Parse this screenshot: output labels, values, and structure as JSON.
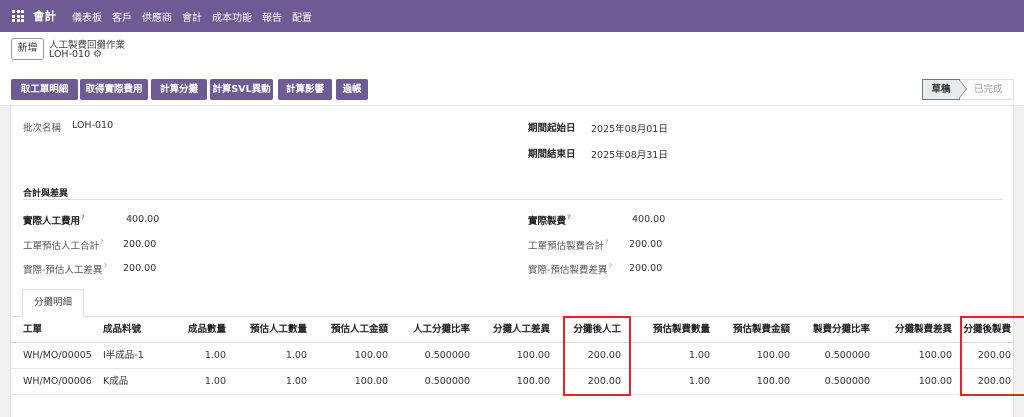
{
  "topnav": {
    "brand": "會計",
    "menu": [
      "儀表板",
      "客戶",
      "供應商",
      "會計",
      "成本功能",
      "報告",
      "配置"
    ]
  },
  "breadcrumb": {
    "new_label": "新增",
    "title": "人工製費回攤作業",
    "record": "LOH-010"
  },
  "actions": [
    "取工單明細",
    "取得實際費用",
    "計算分攤",
    "計算SVL異動",
    "計算影響",
    "過帳"
  ],
  "status": {
    "current": "草稿",
    "next": "已完成"
  },
  "form": {
    "batch_label": "批次名稱",
    "batch_value": "LOH-010",
    "period_start_label": "期間起始日",
    "period_start_value": "2025年08月01日",
    "period_end_label": "期間結束日",
    "period_end_value": "2025年08月31日",
    "section_title": "合計與差異",
    "actual_labor_label": "實際人工費用",
    "actual_labor_value": "400.00",
    "actual_overhead_label": "實際製費",
    "actual_overhead_value": "400.00",
    "wo_est_labor_label": "工單預估人工合計",
    "wo_est_labor_value": "200.00",
    "wo_est_overhead_label": "工單預估製費合計",
    "wo_est_overhead_value": "200.00",
    "labor_diff_label": "實際-預估人工差異",
    "labor_diff_value": "200.00",
    "overhead_diff_label": "實際-預估製費差異",
    "overhead_diff_value": "200.00",
    "help_mark": "?"
  },
  "tab": {
    "label": "分攤明細"
  },
  "table": {
    "columns": [
      "工單",
      "成品料號",
      "成品數量",
      "預估人工數量",
      "預估人工金額",
      "人工分攤比率",
      "分攤人工差異",
      "分攤後人工",
      "預估製費數量",
      "預估製費金額",
      "製費分攤比率",
      "分攤製費差異",
      "分攤後製費"
    ],
    "rows": [
      [
        "WH/MO/00005",
        "I半成品-1",
        "1.00",
        "1.00",
        "100.00",
        "0.500000",
        "100.00",
        "200.00",
        "1.00",
        "100.00",
        "0.500000",
        "100.00",
        "200.00"
      ],
      [
        "WH/MO/00006",
        "K成品",
        "1.00",
        "1.00",
        "100.00",
        "0.500000",
        "100.00",
        "200.00",
        "1.00",
        "100.00",
        "0.500000",
        "100.00",
        "200.00"
      ]
    ]
  },
  "colors": {
    "brand": "#6f5b94",
    "highlight": "#e0262c"
  }
}
